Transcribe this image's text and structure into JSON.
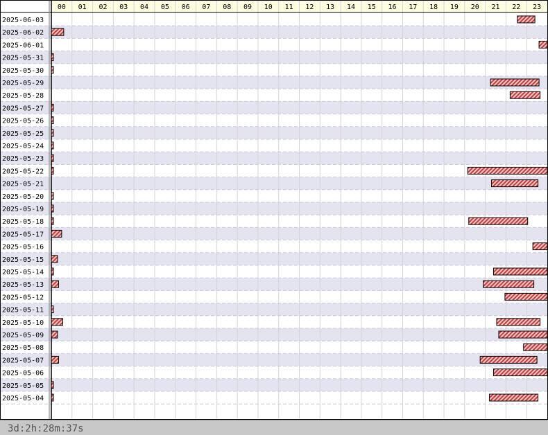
{
  "chart_data": {
    "type": "timeline",
    "x_ticks": [
      "00",
      "01",
      "02",
      "03",
      "04",
      "05",
      "06",
      "07",
      "08",
      "09",
      "10",
      "11",
      "12",
      "13",
      "14",
      "15",
      "16",
      "17",
      "18",
      "19",
      "20",
      "21",
      "22",
      "23"
    ],
    "xlim_hours": [
      0,
      24
    ],
    "grid": true,
    "row_colors": [
      "#ffffff",
      "#e4e4f1"
    ],
    "header_color": "#fffde0",
    "bar_color": "#d14a4a",
    "rows": [
      {
        "date": "2025-06-03",
        "intervals": [
          [
            22.55,
            23.4
          ]
        ]
      },
      {
        "date": "2025-06-02",
        "intervals": [
          [
            0.0,
            0.6
          ]
        ]
      },
      {
        "date": "2025-06-01",
        "intervals": [
          [
            23.6,
            24.0
          ]
        ]
      },
      {
        "date": "2025-05-31",
        "intervals": [
          [
            0.0,
            0.1
          ]
        ]
      },
      {
        "date": "2025-05-30",
        "intervals": [
          [
            0.0,
            0.1
          ]
        ]
      },
      {
        "date": "2025-05-29",
        "intervals": [
          [
            21.25,
            23.6
          ]
        ]
      },
      {
        "date": "2025-05-28",
        "intervals": [
          [
            22.2,
            23.65
          ]
        ]
      },
      {
        "date": "2025-05-27",
        "intervals": [
          [
            0.0,
            0.1
          ]
        ]
      },
      {
        "date": "2025-05-26",
        "intervals": [
          [
            0.0,
            0.1
          ]
        ]
      },
      {
        "date": "2025-05-25",
        "intervals": [
          [
            0.0,
            0.1
          ]
        ]
      },
      {
        "date": "2025-05-24",
        "intervals": [
          [
            0.0,
            0.1
          ]
        ]
      },
      {
        "date": "2025-05-23",
        "intervals": [
          [
            0.0,
            0.1
          ]
        ]
      },
      {
        "date": "2025-05-22",
        "intervals": [
          [
            0.0,
            0.1
          ],
          [
            20.15,
            24.0
          ]
        ]
      },
      {
        "date": "2025-05-21",
        "intervals": [
          [
            21.3,
            23.55
          ]
        ]
      },
      {
        "date": "2025-05-20",
        "intervals": [
          [
            0.0,
            0.1
          ]
        ]
      },
      {
        "date": "2025-05-19",
        "intervals": [
          [
            0.0,
            0.1
          ]
        ]
      },
      {
        "date": "2025-05-18",
        "intervals": [
          [
            0.0,
            0.1
          ],
          [
            20.2,
            23.05
          ]
        ]
      },
      {
        "date": "2025-05-17",
        "intervals": [
          [
            0.0,
            0.5
          ]
        ]
      },
      {
        "date": "2025-05-16",
        "intervals": [
          [
            23.3,
            24.0
          ]
        ]
      },
      {
        "date": "2025-05-15",
        "intervals": [
          [
            0.0,
            0.3
          ]
        ]
      },
      {
        "date": "2025-05-14",
        "intervals": [
          [
            0.0,
            0.1
          ],
          [
            21.4,
            24.0
          ]
        ]
      },
      {
        "date": "2025-05-13",
        "intervals": [
          [
            0.0,
            0.35
          ],
          [
            20.9,
            23.35
          ]
        ]
      },
      {
        "date": "2025-05-12",
        "intervals": [
          [
            21.95,
            24.0
          ]
        ]
      },
      {
        "date": "2025-05-11",
        "intervals": [
          [
            0.0,
            0.1
          ]
        ]
      },
      {
        "date": "2025-05-10",
        "intervals": [
          [
            0.0,
            0.55
          ],
          [
            21.55,
            23.65
          ]
        ]
      },
      {
        "date": "2025-05-09",
        "intervals": [
          [
            0.0,
            0.3
          ],
          [
            21.65,
            24.0
          ]
        ]
      },
      {
        "date": "2025-05-08",
        "intervals": [
          [
            22.85,
            24.0
          ]
        ]
      },
      {
        "date": "2025-05-07",
        "intervals": [
          [
            0.0,
            0.35
          ],
          [
            20.75,
            23.5
          ]
        ]
      },
      {
        "date": "2025-05-06",
        "intervals": [
          [
            21.4,
            24.0
          ]
        ]
      },
      {
        "date": "2025-05-05",
        "intervals": [
          [
            0.0,
            0.1
          ]
        ]
      },
      {
        "date": "2025-05-04",
        "intervals": [
          [
            0.0,
            0.1
          ],
          [
            21.2,
            23.55
          ]
        ]
      }
    ]
  },
  "footer": {
    "total_duration": "3d:2h:28m:37s"
  }
}
